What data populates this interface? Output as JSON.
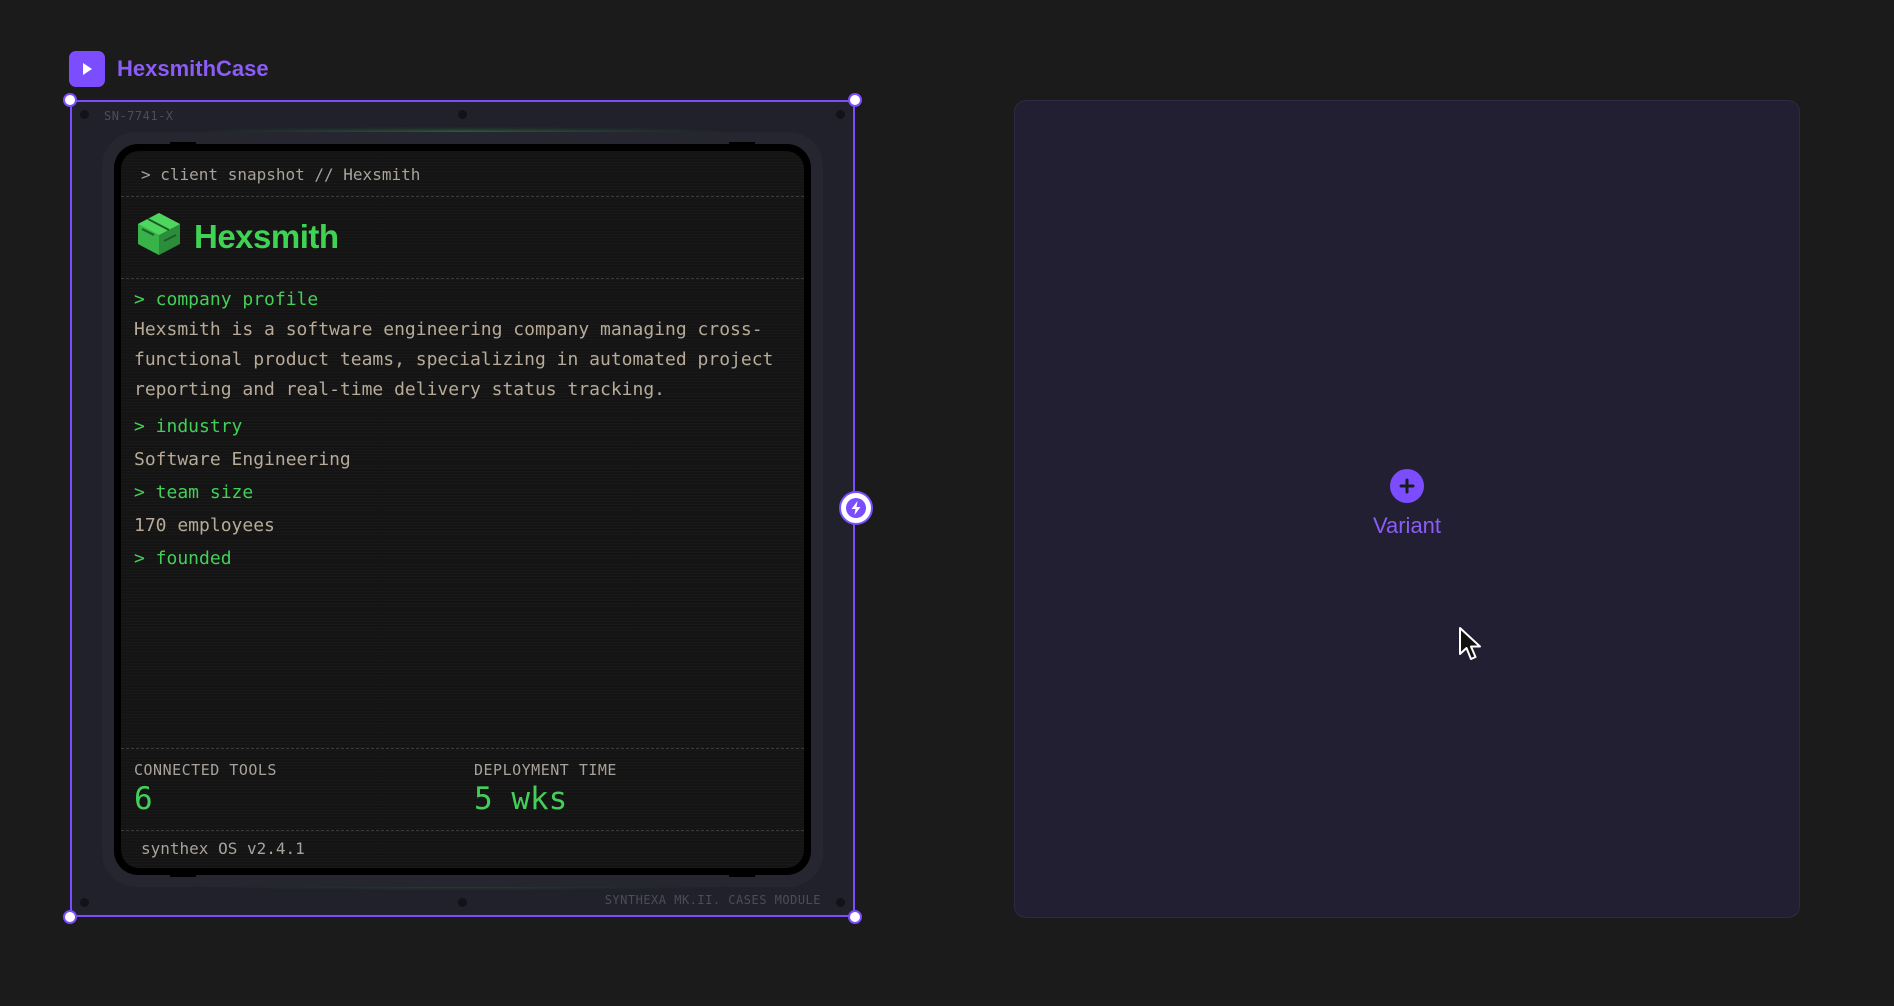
{
  "component": {
    "name": "HexsmithCase",
    "icon": "play-icon"
  },
  "device": {
    "serial": "SN-7741-X",
    "module_label": "SYNTHEXA MK.II. CASES MODULE"
  },
  "screen": {
    "header": "> client snapshot // Hexsmith",
    "logo_text": "Hexsmith",
    "sections": {
      "profile_label": "> company profile",
      "profile_text": "Hexsmith is a software engineering company managing cross-functional product teams, specializing in automated project reporting and real-time delivery status tracking.",
      "industry_label": "> industry",
      "industry_value": "Software Engineering",
      "team_label": "> team size",
      "team_value": "170 employees",
      "founded_label": "> founded"
    },
    "stats": [
      {
        "label": "CONNECTED TOOLS",
        "value": "6"
      },
      {
        "label": "DEPLOYMENT TIME",
        "value": "5 wks"
      }
    ],
    "footer": "synthex OS v2.4.1"
  },
  "variant": {
    "label": "Variant",
    "icon": "plus-icon"
  },
  "colors": {
    "accent": "#7c4dff",
    "terminal_green": "#43cf58",
    "terminal_text": "#b7aa98"
  }
}
